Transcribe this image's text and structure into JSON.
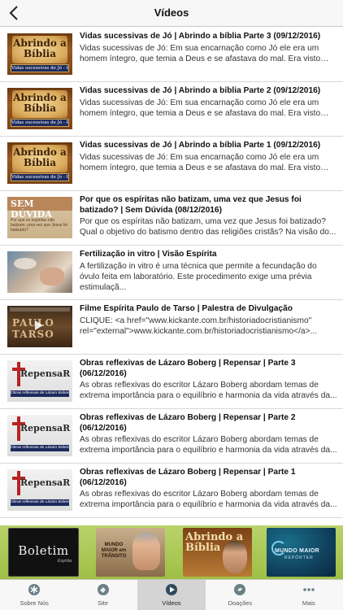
{
  "header": {
    "title": "Vídeos",
    "back_icon": "chevron-left-icon"
  },
  "videos": [
    {
      "thumb": "abrindo",
      "thumb_title": "Abrindo a Bíblia",
      "thumb_caption": "Vidas sucessivas de Jó - Parte 3",
      "title": "Vidas sucessivas de Jó | Abrindo a bíblia Parte 3 (09/12/2016)",
      "description": "Vidas sucessivas de Jó: Em sua encarnação como Jó ele era um homem íntegro, que temia a Deus e se afastava do mal. Era visto co..."
    },
    {
      "thumb": "abrindo",
      "thumb_title": "Abrindo a Bíblia",
      "thumb_caption": "Vidas sucessivas de Jó - Parte 2",
      "title": "Vidas sucessivas de Jó | Abrindo a bíblia Parte 2 (09/12/2016)",
      "description": "Vidas sucessivas de Jó: Em sua encarnação como Jó ele era um homem íntegro, que temia a Deus e se afastava do mal. Era visto co..."
    },
    {
      "thumb": "abrindo",
      "thumb_title": "Abrindo a Bíblia",
      "thumb_caption": "Vidas sucessivas de Jó - Parte 1",
      "title": "Vidas sucessivas de Jó | Abrindo a bíblia Parte 1 (09/12/2016)",
      "description": "Vidas sucessivas de Jó: Em sua encarnação como Jó ele era um homem íntegro, que temia a Deus e se afastava do mal. Era visto co..."
    },
    {
      "thumb": "semduvida",
      "thumb_title": "SEM DÚVIDA",
      "thumb_caption": "Por que os espíritas não batizam, uma vez que Jesus foi batizado?",
      "title": "Por que os espíritas não batizam, uma vez que Jesus foi batizado? | Sem Dúvida (08/12/2016)",
      "description": "Por que os espíritas não batizam, uma vez que Jesus foi batizado? Qual o objetivo do batismo dentro das religiões cristãs? Na visão do..."
    },
    {
      "thumb": "fertilizacao",
      "thumb_title": "",
      "thumb_caption": "",
      "title": "Fertilização in vitro | Visão Espírita",
      "description": "A fertilização in vitro é uma técnica que permite a fecundação do óvulo feita em laboratório. Este procedimento exige uma prévia estimulaçã..."
    },
    {
      "thumb": "paulotarso",
      "thumb_title": "PAULO TARSO",
      "thumb_caption": "",
      "title": "Filme Espírita Paulo de Tarso | Palestra de Divulgação",
      "description": "CLIQUE: <a href=\"www.kickante.com.br/historiadocristianismo\" rel=\"external\">www.kickante.com.br/historiadocristianismo</a>..."
    },
    {
      "thumb": "repensar",
      "thumb_title": "RepensaR",
      "thumb_caption": "Obras reflexivas de Lázaro Boberg - Parte 3",
      "title": "Obras reflexivas de Lázaro Boberg | Repensar | Parte 3 (06/12/2016)",
      "description": "As obras reflexivas do escritor Lázaro Boberg abordam temas de extrema importância para o equilíbrio e harmonia da vida através da..."
    },
    {
      "thumb": "repensar",
      "thumb_title": "RepensaR",
      "thumb_caption": "Obras reflexivas de Lázaro Boberg - Parte 2",
      "title": "Obras reflexivas de Lázaro Boberg | Repensar | Parte 2 (06/12/2016)",
      "description": "As obras reflexivas do escritor Lázaro Boberg abordam temas de extrema importância para o equilíbrio e harmonia da vida através da..."
    },
    {
      "thumb": "repensar",
      "thumb_title": "RepensaR",
      "thumb_caption": "Obras reflexivas de Lázaro Boberg - Parte 1",
      "title": "Obras reflexivas de Lázaro Boberg | Repensar | Parte 1 (06/12/2016)",
      "description": "As obras reflexivas do escritor Lázaro Boberg abordam temas de extrema importância para o equilíbrio e harmonia da vida através da..."
    }
  ],
  "banner": {
    "boletim": {
      "title": "Boletim",
      "subtitle": "Espírita"
    },
    "mundo_maior_tv": {
      "title": "MUNDO MAIOR em TRÂNSITO"
    },
    "abrindo": {
      "title": "Abrindo a Bíblia"
    },
    "reporter": {
      "title": "MUNDO MAIOR",
      "subtitle": "REPÓRTER"
    }
  },
  "tabs": [
    {
      "label": "Sobre Nós",
      "icon": "asterisk-icon",
      "active": false
    },
    {
      "label": "Site",
      "icon": "globe-icon",
      "active": false
    },
    {
      "label": "Vídeos",
      "icon": "play-icon",
      "active": true
    },
    {
      "label": "Doações",
      "icon": "donate-icon",
      "active": false
    },
    {
      "label": "Mais",
      "icon": "more-icon",
      "active": false
    }
  ],
  "colors": {
    "accent_green": "#a8c84f",
    "header_bg": "#f7f7f7",
    "tab_active": "#d4d4d4"
  }
}
